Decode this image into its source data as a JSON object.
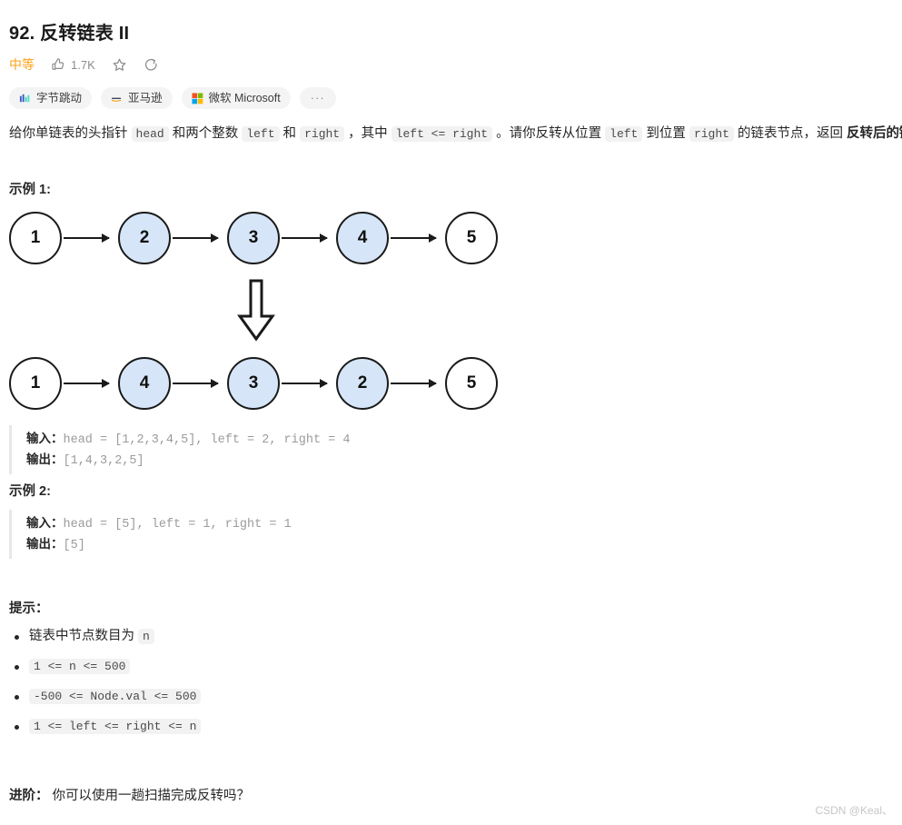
{
  "problem": {
    "title": "92. 反转链表 II",
    "difficulty": "中等",
    "likes": "1.7K"
  },
  "icons": {
    "thumbs_up": "thumbs-up-icon",
    "star": "star-icon",
    "share": "share-icon"
  },
  "company_tags": [
    {
      "label": "字节跳动",
      "icon": "bytedance-icon"
    },
    {
      "label": "亚马逊",
      "icon": "amazon-icon"
    },
    {
      "label": "微软 Microsoft",
      "icon": "microsoft-icon"
    },
    {
      "label": "···",
      "icon": "more-icon"
    }
  ],
  "description": {
    "seg1": "给你单链表的头指针 ",
    "code1": "head",
    "seg2": " 和两个整数 ",
    "code2": "left",
    "seg3": " 和 ",
    "code3": "right",
    "seg4": " ，其中 ",
    "code4": "left <= right",
    "seg5": " 。请你反转从位置 ",
    "code5": "left",
    "seg6": " 到位置 ",
    "code6": "right",
    "seg7": " 的链表节点，返回 ",
    "bold1": "反转后的链表",
    "seg8": " 。"
  },
  "examples": [
    {
      "heading": "示例 1:",
      "input_label": "输入：",
      "input_value": "head = [1,2,3,4,5], left = 2, right = 4",
      "output_label": "输出：",
      "output_value": "[1,4,3,2,5]"
    },
    {
      "heading": "示例 2:",
      "input_label": "输入：",
      "input_value": "head = [5], left = 1, right = 1",
      "output_label": "输出：",
      "output_value": "[5]"
    }
  ],
  "diagram": {
    "before": [
      {
        "value": "1",
        "highlighted": false
      },
      {
        "value": "2",
        "highlighted": true
      },
      {
        "value": "3",
        "highlighted": true
      },
      {
        "value": "4",
        "highlighted": true
      },
      {
        "value": "5",
        "highlighted": false
      }
    ],
    "after": [
      {
        "value": "1",
        "highlighted": false
      },
      {
        "value": "4",
        "highlighted": true
      },
      {
        "value": "3",
        "highlighted": true
      },
      {
        "value": "2",
        "highlighted": true
      },
      {
        "value": "5",
        "highlighted": false
      }
    ],
    "highlight_color": "#d6e6f8",
    "node_border_color": "#1a1a1a",
    "transform_arrow": "down-arrow-icon"
  },
  "hints": {
    "heading": "提示：",
    "items": [
      {
        "text": "链表中节点数目为 ",
        "code": "n",
        "code_first": false
      },
      {
        "text": "",
        "code": "1 <= n <= 500",
        "code_first": true
      },
      {
        "text": "",
        "code": "-500 <= Node.val <= 500",
        "code_first": true
      },
      {
        "text": "",
        "code": "1 <= left <= right <= n",
        "code_first": true
      }
    ]
  },
  "followup": {
    "label": "进阶：",
    "text": " 你可以使用一趟扫描完成反转吗？"
  },
  "watermark": "CSDN @Keal、"
}
